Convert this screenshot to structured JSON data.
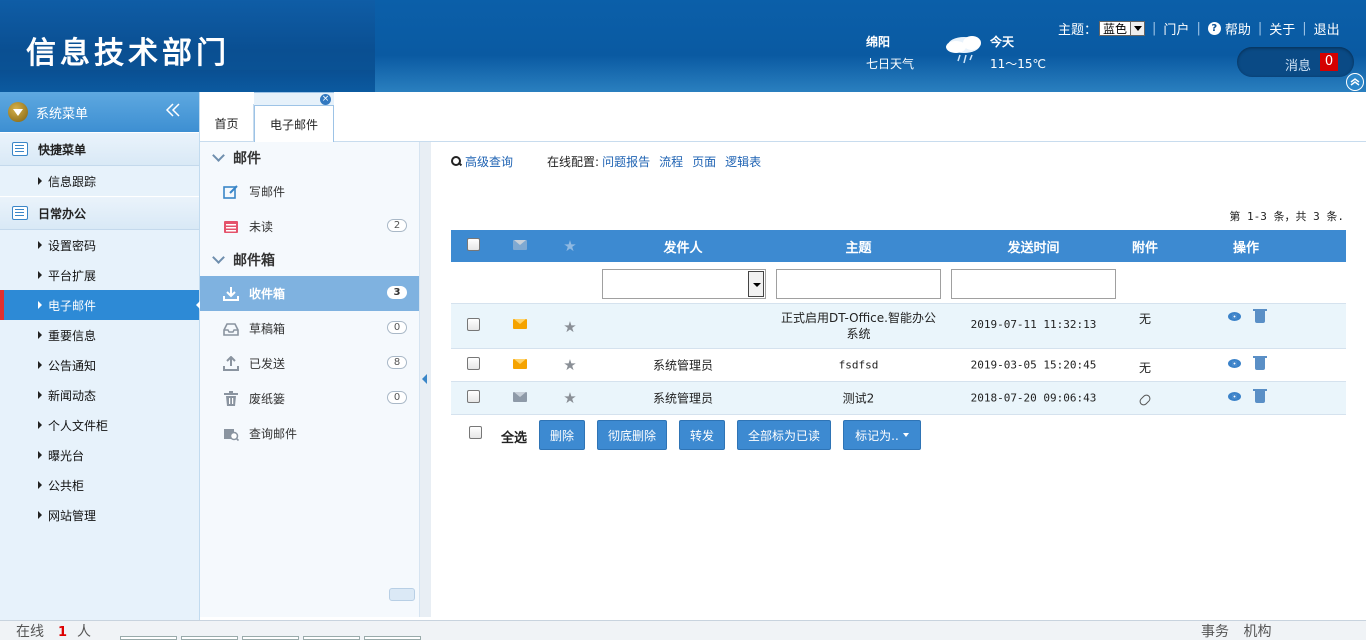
{
  "header": {
    "title": "信息技术部门",
    "weather": {
      "city": "绵阳",
      "week_link": "七日天气",
      "today_label": "今天",
      "temperature": "11～15℃"
    },
    "theme_label": "主题：",
    "theme_value": "蓝色",
    "links": {
      "portal": "门户",
      "help": "帮助",
      "about": "关于",
      "logout": "退出"
    },
    "message_label": "消息",
    "message_count": "0"
  },
  "sidebar": {
    "title": "系统菜单",
    "groups": [
      {
        "label": "快捷菜单",
        "items": [
          "信息跟踪"
        ]
      },
      {
        "label": "日常办公",
        "items": [
          "设置密码",
          "平台扩展",
          "电子邮件",
          "重要信息",
          "公告通知",
          "新闻动态",
          "个人文件柜",
          "曝光台",
          "公共柜",
          "网站管理"
        ]
      }
    ],
    "active_item": "电子邮件"
  },
  "tabs": [
    {
      "label": "首页"
    },
    {
      "label": "电子邮件",
      "active": true
    }
  ],
  "mail_nav": {
    "mail_section": "邮件",
    "compose": "写邮件",
    "unread": "未读",
    "unread_count": "2",
    "mailbox_section": "邮件箱",
    "inbox": "收件箱",
    "inbox_count": "3",
    "drafts": "草稿箱",
    "drafts_count": "0",
    "sent": "已发送",
    "sent_count": "8",
    "trash": "废纸篓",
    "trash_count": "0",
    "search": "查询邮件"
  },
  "toolbar": {
    "advanced_search": "高级查询",
    "online_config_label": "在线配置:",
    "config_links": [
      "问题报告",
      "流程",
      "页面",
      "逻辑表"
    ]
  },
  "pager": "第 1-3 条，共 3 条.",
  "table": {
    "columns": {
      "from": "发件人",
      "subject": "主题",
      "time": "发送时间",
      "attachment": "附件",
      "ops": "操作"
    },
    "rows": [
      {
        "read": false,
        "from": "",
        "subject": "正式启用DT-Office.智能办公系统",
        "time": "2019-07-11 11:32:13",
        "attachment": "无",
        "has_clip": false
      },
      {
        "read": false,
        "from": "系统管理员",
        "subject": "fsdfsd",
        "time": "2019-03-05 15:20:45",
        "attachment": "无",
        "has_clip": false
      },
      {
        "read": true,
        "from": "系统管理员",
        "subject": "测试2",
        "time": "2018-07-20 09:06:43",
        "attachment": "",
        "has_clip": true
      }
    ]
  },
  "actions": {
    "select_all": "全选",
    "delete": "删除",
    "purge": "彻底删除",
    "forward": "转发",
    "mark_all_read": "全部标为已读",
    "mark_as": "标记为.."
  },
  "status": {
    "online_label": "在线",
    "online_count": "1",
    "online_unit": "人",
    "affairs": "事务",
    "org": "机构"
  },
  "colors": {
    "accent": "#3d8ad1",
    "header": "#0b5aa0",
    "badge_red": "#d40000"
  }
}
